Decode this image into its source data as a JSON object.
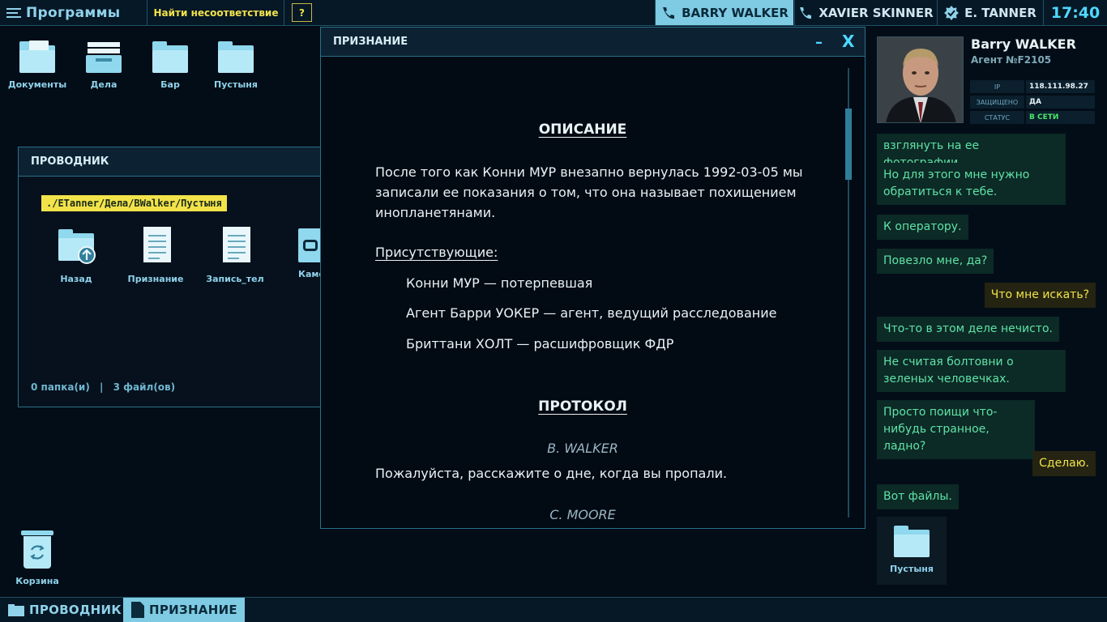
{
  "topbar": {
    "programs_label": "Программы",
    "find_mismatch_label": "Найти несоответствие",
    "help_label": "?",
    "contacts": [
      {
        "name": "BARRY WALKER",
        "icon": "phone-icon"
      },
      {
        "name": "XAVIER SKINNER",
        "icon": "phone-icon"
      },
      {
        "name": "E. TANNER",
        "icon": "badge-icon"
      }
    ],
    "clock": "17:40"
  },
  "desktop": {
    "icons": [
      {
        "label": "Документы",
        "icon": "documents-folder-icon"
      },
      {
        "label": "Дела",
        "icon": "cases-tray-icon"
      },
      {
        "label": "Бар",
        "icon": "folder-icon"
      },
      {
        "label": "Пустыня",
        "icon": "folder-icon"
      }
    ],
    "trash_label": "Корзина"
  },
  "explorer": {
    "title": "ПРОВОДНИК",
    "path": "./ETanner/Дела/BWalker/Пустыня",
    "files": [
      {
        "label": "Назад",
        "icon": "folder-up-icon"
      },
      {
        "label": "Признание",
        "icon": "document-icon"
      },
      {
        "label": "Запись_тел",
        "icon": "document-icon"
      },
      {
        "label": "Каме",
        "icon": "camera-icon"
      }
    ],
    "status_folders": "0 папка(и)",
    "status_sep": "|",
    "status_files": "3 файл(ов)"
  },
  "confession": {
    "title": "ПРИЗНАНИЕ",
    "minimize": "–",
    "close": "X",
    "description_heading": "ОПИСАНИЕ",
    "description_lines": [
      "После того как Конни МУР внезапно вернулась 1992-03-05 мы",
      "записали ее показания о том, что она называет похищением",
      "инопланетянами."
    ],
    "present_heading": "Присутствующие:",
    "present": [
      "Конни МУР — потерпевшая",
      "Агент Барри УОКЕР — агент, ведущий расследование",
      "Бриттани ХОЛТ — расшифровщик ФДР"
    ],
    "protocol_heading": "ПРОТОКОЛ",
    "speaker_1": "B. WALKER",
    "line_1": "Пожалуйста, расскажите о дне, когда вы пропали.",
    "speaker_2": "C. MOORE"
  },
  "contact": {
    "name": "Barry WALKER",
    "agent": "Агент №F2105",
    "info": [
      {
        "key": "IP",
        "value": "118.111.98.27"
      },
      {
        "key": "ЗАЩИЩЕНО",
        "value": "ДА"
      },
      {
        "key": "СТАТУС",
        "value": "В СЕТИ"
      }
    ],
    "messages": [
      {
        "dir": "in",
        "text": "взглянуть на ее фотографии."
      },
      {
        "dir": "in",
        "text": "Но для этого мне нужно обратиться к тебе."
      },
      {
        "dir": "in",
        "text": "К оператору."
      },
      {
        "dir": "in",
        "text": "Повезло мне, да?"
      },
      {
        "dir": "out",
        "text": "Что мне искать?"
      },
      {
        "dir": "in",
        "text": "Что-то в этом деле нечисто."
      },
      {
        "dir": "in",
        "text": "Не считая болтовни о зеленых человечках."
      },
      {
        "dir": "in",
        "text": "Просто поищи что-нибудь странное, ладно?"
      },
      {
        "dir": "out",
        "text": "Сделаю."
      },
      {
        "dir": "in",
        "text": "Вот файлы."
      }
    ],
    "shared_folder": "Пустыня"
  },
  "taskbar": {
    "explorer": "ПРОВОДНИК",
    "confession": "ПРИЗНАНИЕ"
  },
  "colors": {
    "accent": "#4fd8ff",
    "highlight": "#f2e34a",
    "chat_in": "#5fe3a7",
    "online": "#49e86a"
  }
}
